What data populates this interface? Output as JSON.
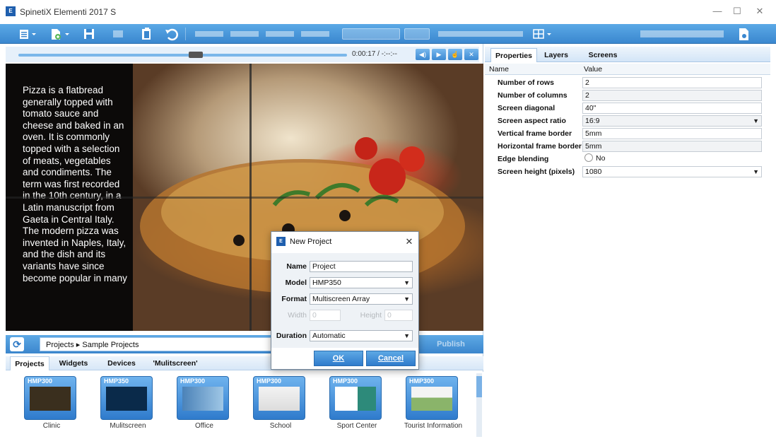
{
  "window": {
    "title": "SpinetiX Elementi 2017 S",
    "logo_text": "E"
  },
  "window_controls": {
    "minimize": "—",
    "maximize": "☐",
    "close": "✕"
  },
  "player": {
    "time": "0:00:17 / -:--:--",
    "progress": 0.54
  },
  "preview": {
    "text": "Pizza is a flatbread generally topped with tomato sauce and cheese and baked in an oven. It is commonly topped with a selection of meats, vegetables and condiments. The term was first recorded in the 10th century, in a Latin manuscript from Gaeta in Central Italy. The modern pizza was invented in Naples, Italy, and the dish and its variants have since become popular in many"
  },
  "library": {
    "breadcrumb": "Projects  ▸  Sample Projects",
    "publish_label": "Publish",
    "tabs": [
      "Projects",
      "Widgets",
      "Devices",
      "'Mulitscreen'"
    ],
    "active_tab": "Projects",
    "items": [
      {
        "model": "HMP300",
        "label": "Clinic",
        "theme": "#3a2f1e"
      },
      {
        "model": "HMP350",
        "label": "Mulitscreen",
        "theme": "#0a2a4a"
      },
      {
        "model": "HMP300",
        "label": "Office",
        "theme": "#4b82b8"
      },
      {
        "model": "HMP300",
        "label": "School",
        "theme": "#e8e8e8"
      },
      {
        "model": "HMP300",
        "label": "Sport Center",
        "theme": "#2d8a7a"
      },
      {
        "model": "HMP300",
        "label": "Tourist Information",
        "theme": "#8ab46a"
      }
    ]
  },
  "properties_panel": {
    "tabs": [
      "Properties",
      "Layers",
      "Screens"
    ],
    "active_tab": "Properties",
    "header": {
      "name": "Name",
      "value": "Value"
    },
    "rows": [
      {
        "name": "Number of rows",
        "value": "2"
      },
      {
        "name": "Number of columns",
        "value": "2"
      },
      {
        "name": "Screen diagonal",
        "value": "40\""
      },
      {
        "name": "Screen aspect ratio",
        "value": "16:9"
      },
      {
        "name": "Vertical frame border",
        "value": "5mm"
      },
      {
        "name": "Horizontal frame border",
        "value": "5mm"
      },
      {
        "name": "Edge blending",
        "value": "No"
      },
      {
        "name": "Screen height (pixels)",
        "value": "1080"
      }
    ]
  },
  "dialog": {
    "title": "New Project",
    "close": "✕",
    "name_label": "Name",
    "name_value": "Project",
    "model_label": "Model",
    "model_value": "HMP350",
    "format_label": "Format",
    "format_value": "Multiscreen Array",
    "width_label": "Width",
    "width_value": "0",
    "height_label": "Height",
    "height_value": "0",
    "duration_label": "Duration",
    "duration_value": "Automatic",
    "ok_label": "OK",
    "cancel_label": "Cancel"
  },
  "colors": {
    "toolbar": "#3a87cf",
    "accent": "#2f7bcc"
  }
}
